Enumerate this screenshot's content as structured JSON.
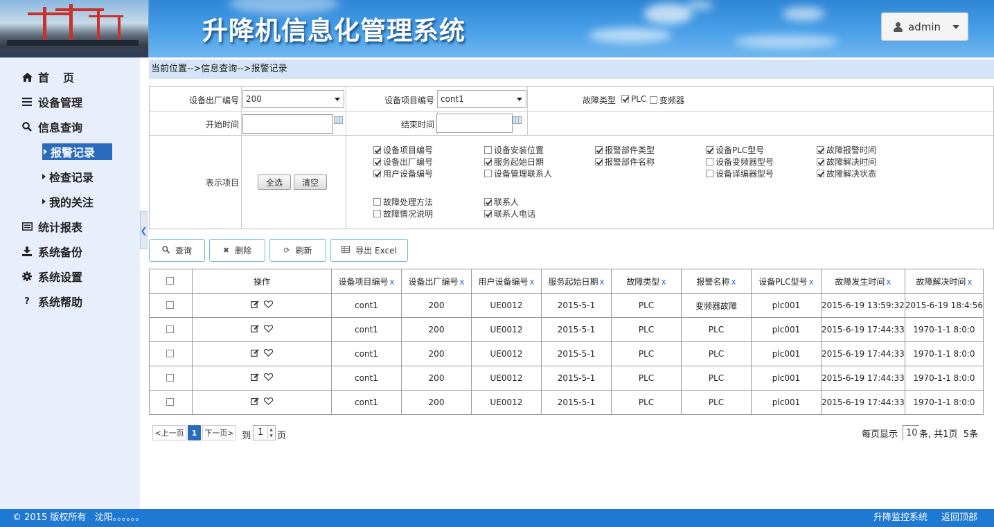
{
  "header": {
    "title": "升降机信息化管理系统",
    "user_label": "admin"
  },
  "sidebar": {
    "items": [
      {
        "label": "首　页",
        "icon": "home-icon"
      },
      {
        "label": "设备管理",
        "icon": "list-icon"
      },
      {
        "label": "信息查询",
        "icon": "search-icon"
      },
      {
        "label": "统计报表",
        "icon": "report-icon"
      },
      {
        "label": "系统备份",
        "icon": "download-icon"
      },
      {
        "label": "系统设置",
        "icon": "gear-icon"
      },
      {
        "label": "系统帮助",
        "icon": "help-icon"
      }
    ],
    "sub_items": [
      {
        "label": "报警记录",
        "active": true
      },
      {
        "label": "检查记录",
        "active": false
      },
      {
        "label": "我的关注",
        "active": false
      }
    ]
  },
  "breadcrumb": "当前位置-->信息查询-->报警记录",
  "filter": {
    "serial_label": "设备出厂编号",
    "serial_value": "200",
    "project_label": "设备项目编号",
    "project_value": "cont1",
    "fault_type_label": "故障类型",
    "fault_plc": "PLC",
    "fault_inverter": "变频器",
    "start_label": "开始时间",
    "end_label": "结束时间",
    "display_label": "表示项目",
    "select_all": "全选",
    "clear": "清空",
    "columns": [
      {
        "label": "设备项目编号",
        "checked": true
      },
      {
        "label": "设备安装位置",
        "checked": false
      },
      {
        "label": "报警部件类型",
        "checked": true
      },
      {
        "label": "设备PLC型号",
        "checked": true
      },
      {
        "label": "故障报警时间",
        "checked": true
      },
      {
        "label": "设备出厂编号",
        "checked": true
      },
      {
        "label": "服务起始日期",
        "checked": true
      },
      {
        "label": "报警部件名称",
        "checked": true
      },
      {
        "label": "设备变频器型号",
        "checked": false
      },
      {
        "label": "故障解决时间",
        "checked": true
      },
      {
        "label": "用户设备编号",
        "checked": true
      },
      {
        "label": "设备管理联系人",
        "checked": false
      },
      {
        "label": "设备译编器型号",
        "checked": false
      },
      {
        "label": "故障解决状态",
        "checked": true
      },
      {
        "label": "故障处理方法",
        "checked": false
      },
      {
        "label": "联系人",
        "checked": true
      },
      {
        "label": "故障情况说明",
        "checked": false
      },
      {
        "label": "联系人电话",
        "checked": true
      }
    ]
  },
  "actions": {
    "query": "查询",
    "delete": "删除",
    "refresh": "刷新",
    "export": "导出 Excel"
  },
  "table": {
    "op_header": "操作",
    "headers": [
      "设备项目编号",
      "设备出厂编号",
      "用户设备编号",
      "服务起始日期",
      "故障类型",
      "报警名称",
      "设备PLC型号",
      "故障发生时间",
      "故障解决时间"
    ],
    "close_mark": "x",
    "rows": [
      [
        "cont1",
        "200",
        "UE0012",
        "2015-5-1",
        "PLC",
        "变频器故障",
        "plc001",
        "2015-6-19 13:59:32",
        "2015-6-19 18:4:56"
      ],
      [
        "cont1",
        "200",
        "UE0012",
        "2015-5-1",
        "PLC",
        "PLC",
        "plc001",
        "2015-6-19 17:44:33",
        "1970-1-1 8:0:0"
      ],
      [
        "cont1",
        "200",
        "UE0012",
        "2015-5-1",
        "PLC",
        "PLC",
        "plc001",
        "2015-6-19 17:44:33",
        "1970-1-1 8:0:0"
      ],
      [
        "cont1",
        "200",
        "UE0012",
        "2015-5-1",
        "PLC",
        "PLC",
        "plc001",
        "2015-6-19 17:44:33",
        "1970-1-1 8:0:0"
      ],
      [
        "cont1",
        "200",
        "UE0012",
        "2015-5-1",
        "PLC",
        "PLC",
        "plc001",
        "2015-6-19 17:44:33",
        "1970-1-1 8:0:0"
      ]
    ]
  },
  "pager": {
    "prev": "<上一页",
    "page": "1",
    "next": "下一页>",
    "goto_label": "到",
    "goto_value": "1",
    "page_unit": "页",
    "per_page_label": "每页显示",
    "per_page_value": "10",
    "summary": "条, 共1页  5条"
  },
  "footer": {
    "copyright": "© 2015 版权所有   沈阳。。。。。。",
    "link1": "升降监控系统",
    "link2": "返回顶部"
  }
}
